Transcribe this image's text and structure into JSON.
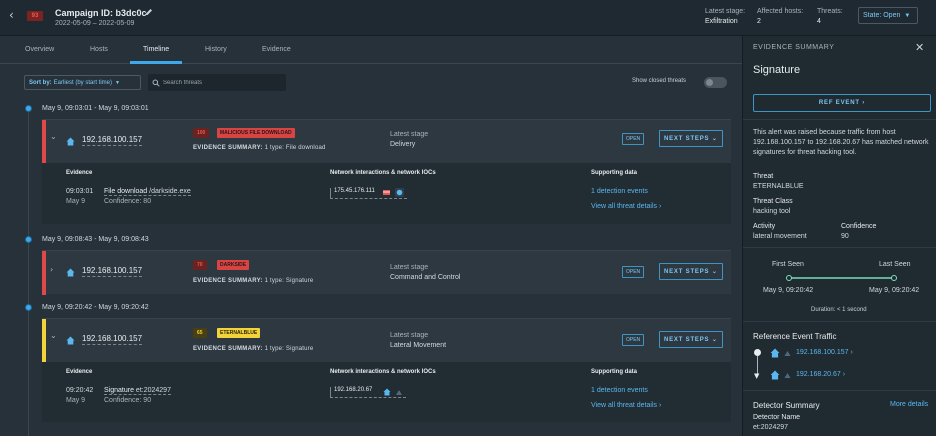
{
  "header": {
    "back_icon": "chevron-left-icon",
    "score": "93",
    "campaign_id": "Campaign ID: b3dc0c",
    "date_range": "2022-05-09 – 2022-05-09",
    "latest_stage_label": "Latest stage:",
    "latest_stage_value": "Exfiltration",
    "affected_hosts_label": "Affected hosts:",
    "affected_hosts_value": "2",
    "threats_label": "Threats:",
    "threats_value": "4",
    "state_label": "State: Open"
  },
  "tabs": [
    "Overview",
    "Hosts",
    "Timeline",
    "History",
    "Evidence"
  ],
  "active_tab": "Timeline",
  "toolbar": {
    "sort_prefix": "Sort by:",
    "sort_value": "Earliest (by start time)",
    "search_placeholder": "Search threats",
    "show_closed_label": "Show closed threats"
  },
  "groups": [
    {
      "date": "May 9, 09:03:01 - May 9, 09:03:01",
      "host": "192.168.100.157",
      "score": "100",
      "tag": "MALICIOUS FILE DOWNLOAD",
      "evidence_summary_label": "EVIDENCE SUMMARY:",
      "evidence_summary": "1 type: File download",
      "latest_stage_label": "Latest stage",
      "latest_stage": "Delivery",
      "open_label": "OPEN",
      "next_steps_label": "NEXT STEPS",
      "expanded": true,
      "detail": {
        "evidence_header": "Evidence",
        "time": "09:03:01",
        "day": "May 9",
        "evidence_link": "File download",
        "evidence_extra": "/darkside.exe",
        "confidence": "Confidence: 80",
        "ioc_header": "Network interactions & network IOCs",
        "ioc": "175.45.176.111",
        "supporting_header": "Supporting data",
        "detection_events": "1 detection events",
        "view_all": "View all threat details"
      }
    },
    {
      "date": "May 9, 09:08:43 - May 9, 09:08:43",
      "host": "192.168.100.157",
      "score": "70",
      "tag": "DARKSIDE",
      "evidence_summary_label": "EVIDENCE SUMMARY:",
      "evidence_summary": "1 type: Signature",
      "latest_stage_label": "Latest stage",
      "latest_stage": "Command and Control",
      "open_label": "OPEN",
      "next_steps_label": "NEXT STEPS",
      "expanded": false
    },
    {
      "date": "May 9, 09:20:42 - May 9, 09:20:42",
      "host": "192.168.100.157",
      "score": "65",
      "tag": "ETERNALBLUE",
      "evidence_summary_label": "EVIDENCE SUMMARY:",
      "evidence_summary": "1 type: Signature",
      "latest_stage_label": "Latest stage",
      "latest_stage": "Lateral Movement",
      "open_label": "OPEN",
      "next_steps_label": "NEXT STEPS",
      "expanded": true,
      "detail": {
        "evidence_header": "Evidence",
        "time": "09:20:42",
        "day": "May 9",
        "evidence_link": "Signature",
        "evidence_extra": "et:2024297",
        "confidence": "Confidence: 90",
        "ioc_header": "Network interactions & network IOCs",
        "ioc": "192.168.20.67",
        "supporting_header": "Supporting data",
        "detection_events": "1 detection events",
        "view_all": "View all threat details"
      }
    }
  ],
  "panel": {
    "header": "EVIDENCE SUMMARY",
    "title": "Signature",
    "ref_event_button": "REF EVENT",
    "description": "This alert was raised because traffic from host 192.168.100.157 to 192.168.20.67 has matched network signatures for threat hacking tool.",
    "threat_label": "Threat",
    "threat_value": "ETERNALBLUE",
    "threat_class_label": "Threat Class",
    "threat_class_value": "hacking tool",
    "activity_label": "Activity",
    "activity_value": "lateral movement",
    "confidence_label": "Confidence",
    "confidence_value": "90",
    "first_seen_label": "First Seen",
    "last_seen_label": "Last Seen",
    "first_seen_value": "May 9, 09:20:42",
    "last_seen_value": "May 9, 09:20:42",
    "duration": "Duration: < 1 second",
    "ref_traffic_title": "Reference Event Traffic",
    "ref_source_ip": "192.168.100.157",
    "ref_dest_ip": "192.168.20.67",
    "detector_summary_title": "Detector Summary",
    "more_details": "More details",
    "detector_name_label": "Detector Name",
    "detector_name_value": "et:2024297"
  },
  "colors": {
    "accent": "#3ea8ea",
    "severity_red": "#e8574f",
    "tag_red": "#d64543",
    "tag_yellow": "#f2d43a",
    "link": "#5bb7ef"
  }
}
